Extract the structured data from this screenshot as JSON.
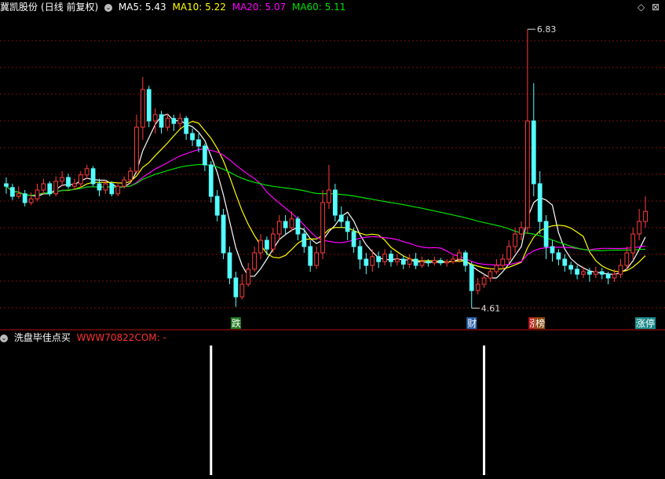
{
  "header": {
    "stock_name": "冀凯股份",
    "period": "(日线 前复权)",
    "ma": [
      {
        "label": "MA5: 5.43",
        "color": "#ffffff"
      },
      {
        "label": "MA10: 5.22",
        "color": "#ffff00"
      },
      {
        "label": "MA20: 5.07",
        "color": "#ff00ff"
      },
      {
        "label": "MA60: 5.11",
        "color": "#00e000"
      }
    ],
    "icons": [
      "diamond-icon",
      "expand-icon"
    ]
  },
  "indicator": {
    "name": "洗盘毕佳点买",
    "site": "WWW70822COM: -"
  },
  "chart_data": {
    "type": "candlestick",
    "y_range": [
      4.55,
      6.95
    ],
    "max_label": "6.83",
    "min_label": "4.61",
    "candles": [
      [
        5.6,
        5.58,
        5.65,
        5.52
      ],
      [
        5.57,
        5.5,
        5.6,
        5.47
      ],
      [
        5.5,
        5.52,
        5.58,
        5.48
      ],
      [
        5.52,
        5.45,
        5.55,
        5.42
      ],
      [
        5.45,
        5.48,
        5.53,
        5.43
      ],
      [
        5.48,
        5.55,
        5.6,
        5.46
      ],
      [
        5.55,
        5.6,
        5.64,
        5.52
      ],
      [
        5.6,
        5.52,
        5.62,
        5.5
      ],
      [
        5.52,
        5.62,
        5.66,
        5.5
      ],
      [
        5.62,
        5.65,
        5.7,
        5.58
      ],
      [
        5.65,
        5.58,
        5.68,
        5.56
      ],
      [
        5.58,
        5.6,
        5.64,
        5.55
      ],
      [
        5.6,
        5.67,
        5.7,
        5.57
      ],
      [
        5.67,
        5.72,
        5.75,
        5.64
      ],
      [
        5.72,
        5.6,
        5.74,
        5.58
      ],
      [
        5.6,
        5.55,
        5.64,
        5.5
      ],
      [
        5.55,
        5.6,
        5.63,
        5.52
      ],
      [
        5.6,
        5.52,
        5.62,
        5.5
      ],
      [
        5.52,
        5.58,
        5.61,
        5.5
      ],
      [
        5.58,
        5.63,
        5.66,
        5.56
      ],
      [
        5.63,
        5.7,
        5.73,
        5.6
      ],
      [
        5.7,
        6.05,
        6.15,
        5.68
      ],
      [
        6.05,
        6.35,
        6.45,
        5.95
      ],
      [
        6.35,
        6.1,
        6.38,
        6.05
      ],
      [
        6.1,
        6.15,
        6.2,
        6.0
      ],
      [
        6.15,
        6.05,
        6.18,
        6.0
      ],
      [
        6.05,
        6.12,
        6.16,
        6.02
      ],
      [
        6.12,
        6.08,
        6.15,
        6.02
      ],
      [
        6.08,
        6.12,
        6.16,
        6.04
      ],
      [
        6.12,
        6.0,
        6.14,
        5.95
      ],
      [
        6.0,
        5.95,
        6.04,
        5.9
      ],
      [
        5.95,
        5.9,
        6.0,
        5.85
      ],
      [
        5.9,
        5.75,
        5.92,
        5.7
      ],
      [
        5.75,
        5.5,
        5.78,
        5.45
      ],
      [
        5.5,
        5.35,
        5.55,
        5.3
      ],
      [
        5.35,
        5.05,
        5.4,
        5.0
      ],
      [
        5.05,
        4.85,
        5.1,
        4.8
      ],
      [
        4.85,
        4.7,
        4.9,
        4.62
      ],
      [
        4.7,
        4.8,
        4.88,
        4.68
      ],
      [
        4.8,
        4.92,
        4.97,
        4.78
      ],
      [
        4.92,
        5.05,
        5.1,
        4.9
      ],
      [
        5.05,
        5.15,
        5.2,
        5.0
      ],
      [
        5.15,
        5.08,
        5.18,
        5.03
      ],
      [
        5.08,
        5.2,
        5.25,
        5.05
      ],
      [
        5.2,
        5.3,
        5.35,
        5.15
      ],
      [
        5.3,
        5.25,
        5.35,
        5.2
      ],
      [
        5.25,
        5.32,
        5.38,
        5.22
      ],
      [
        5.32,
        5.2,
        5.34,
        5.15
      ],
      [
        5.2,
        5.1,
        5.25,
        5.05
      ],
      [
        5.1,
        4.95,
        5.15,
        4.9
      ],
      [
        4.95,
        5.05,
        5.1,
        4.92
      ],
      [
        5.05,
        5.45,
        5.55,
        5.0
      ],
      [
        5.45,
        5.55,
        5.75,
        5.4
      ],
      [
        5.55,
        5.35,
        5.6,
        5.3
      ],
      [
        5.35,
        5.3,
        5.42,
        5.25
      ],
      [
        5.3,
        5.22,
        5.34,
        5.15
      ],
      [
        5.22,
        5.1,
        5.25,
        5.05
      ],
      [
        5.1,
        5.0,
        5.15,
        4.92
      ],
      [
        5.0,
        4.95,
        5.05,
        4.88
      ],
      [
        4.95,
        5.02,
        5.08,
        4.9
      ],
      [
        5.02,
        4.98,
        5.06,
        4.93
      ],
      [
        4.98,
        5.04,
        5.08,
        4.95
      ],
      [
        5.04,
        4.98,
        5.07,
        4.94
      ],
      [
        4.98,
        5.0,
        5.04,
        4.95
      ],
      [
        5.0,
        4.96,
        5.03,
        4.92
      ],
      [
        4.96,
        5.0,
        5.04,
        4.93
      ],
      [
        5.0,
        4.95,
        5.05,
        4.92
      ],
      [
        4.95,
        4.98,
        5.02,
        4.93
      ],
      [
        4.98,
        4.97,
        5.0,
        4.94
      ],
      [
        4.97,
        4.99,
        5.02,
        4.95
      ],
      [
        4.99,
        4.97,
        5.01,
        4.95
      ],
      [
        4.97,
        4.98,
        5.0,
        4.94
      ],
      [
        4.98,
        5.0,
        5.03,
        4.96
      ],
      [
        5.0,
        5.05,
        5.08,
        4.97
      ],
      [
        5.05,
        4.95,
        5.07,
        4.9
      ],
      [
        4.95,
        4.75,
        4.98,
        4.61
      ],
      [
        4.75,
        4.8,
        4.85,
        4.72
      ],
      [
        4.8,
        4.85,
        4.88,
        4.77
      ],
      [
        4.85,
        4.9,
        4.93,
        4.82
      ],
      [
        4.9,
        4.95,
        5.0,
        4.88
      ],
      [
        4.95,
        5.0,
        5.04,
        4.92
      ],
      [
        5.0,
        5.1,
        5.15,
        4.97
      ],
      [
        5.1,
        5.2,
        5.25,
        5.05
      ],
      [
        5.2,
        5.25,
        5.3,
        5.15
      ],
      [
        5.25,
        6.1,
        6.83,
        5.2
      ],
      [
        6.1,
        5.6,
        6.4,
        5.5
      ],
      [
        5.6,
        5.3,
        5.7,
        5.2
      ],
      [
        5.3,
        5.1,
        5.35,
        5.0
      ],
      [
        5.1,
        5.05,
        5.15,
        4.98
      ],
      [
        5.05,
        5.0,
        5.08,
        4.95
      ],
      [
        5.0,
        4.95,
        5.04,
        4.9
      ],
      [
        4.95,
        4.92,
        4.98,
        4.88
      ],
      [
        4.92,
        4.88,
        4.95,
        4.84
      ],
      [
        4.88,
        4.9,
        4.94,
        4.85
      ],
      [
        4.9,
        4.88,
        4.93,
        4.82
      ],
      [
        4.88,
        4.9,
        4.94,
        4.85
      ],
      [
        4.9,
        4.88,
        4.93,
        4.84
      ],
      [
        4.88,
        4.85,
        4.9,
        4.8
      ],
      [
        4.85,
        4.88,
        4.92,
        4.82
      ],
      [
        4.88,
        4.95,
        5.0,
        4.85
      ],
      [
        4.95,
        5.05,
        5.1,
        4.92
      ],
      [
        5.05,
        5.2,
        5.25,
        5.0
      ],
      [
        5.2,
        5.3,
        5.4,
        5.15
      ],
      [
        5.3,
        5.38,
        5.5,
        5.25
      ]
    ],
    "markers": [
      {
        "i": 37,
        "text": "跌",
        "color": "#ffffff",
        "bg": "#1e7a1e"
      },
      {
        "i": 75,
        "text": "财",
        "color": "#ffffff",
        "bg": "#2a5fa8"
      },
      {
        "i": 85,
        "text": "涨",
        "color": "#ffffff",
        "bg": "#c02020"
      },
      {
        "i": 86,
        "text": "榜",
        "color": "#ffffff",
        "bg": "#8a4a10"
      },
      {
        "i": 103,
        "text": "涨停",
        "color": "#ffffff",
        "bg": "#1a8a8a"
      }
    ],
    "signals": [
      33,
      77
    ],
    "ma_periods": [
      5,
      10,
      20,
      60
    ],
    "ma_colors": [
      "#ffffff",
      "#ffff00",
      "#ff00ff",
      "#00e000"
    ]
  }
}
